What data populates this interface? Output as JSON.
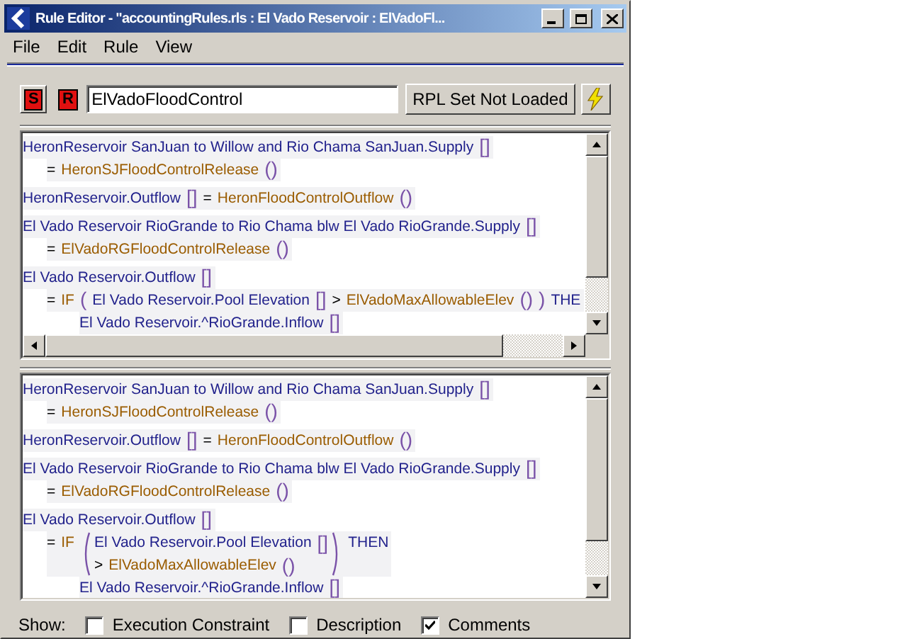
{
  "window": {
    "title": "Rule Editor - \"accountingRules.rls : El Vado Reservoir : ElVadoFl..."
  },
  "menu": [
    "File",
    "Edit",
    "Rule",
    "View"
  ],
  "toolbar": {
    "s_label": "S",
    "r_label": "R",
    "rule_name": "ElVadoFloodControl",
    "status_button": "RPL Set Not Loaded"
  },
  "panels": [
    {
      "horizontal_scrollbar": true,
      "rules": [
        {
          "lines": [
            {
              "kind": "head",
              "tokens": [
                {
                  "kind": "object",
                  "text": "HeronReservoir SanJuan to Willow and Rio Chama SanJuan.Supply"
                },
                {
                  "kind": "symbol",
                  "text": "[]"
                }
              ]
            },
            {
              "kind": "body",
              "tokens": [
                {
                  "kind": "operator",
                  "text": "="
                },
                {
                  "kind": "function",
                  "text": "HeronSJFloodControlRelease"
                },
                {
                  "kind": "symbol",
                  "text": "()"
                }
              ]
            }
          ]
        },
        {
          "lines": [
            {
              "kind": "head",
              "tokens": [
                {
                  "kind": "object",
                  "text": "HeronReservoir.Outflow"
                },
                {
                  "kind": "symbol",
                  "text": "[]"
                },
                {
                  "kind": "operator",
                  "text": "="
                },
                {
                  "kind": "function",
                  "text": "HeronFloodControlOutflow"
                },
                {
                  "kind": "symbol",
                  "text": "()"
                }
              ]
            }
          ]
        },
        {
          "lines": [
            {
              "kind": "head",
              "tokens": [
                {
                  "kind": "object",
                  "text": "El Vado Reservoir RioGrande to Rio Chama blw El Vado RioGrande.Supply"
                },
                {
                  "kind": "symbol",
                  "text": "[]"
                }
              ]
            },
            {
              "kind": "body",
              "tokens": [
                {
                  "kind": "operator",
                  "text": "="
                },
                {
                  "kind": "function",
                  "text": "ElVadoRGFloodControlRelease"
                },
                {
                  "kind": "symbol",
                  "text": "()"
                }
              ]
            }
          ]
        },
        {
          "lines": [
            {
              "kind": "head",
              "tokens": [
                {
                  "kind": "object",
                  "text": "El Vado Reservoir.Outflow"
                },
                {
                  "kind": "symbol",
                  "text": "[]"
                }
              ]
            },
            {
              "kind": "body",
              "tokens": [
                {
                  "kind": "operator",
                  "text": "="
                },
                {
                  "kind": "keyword",
                  "text": "IF"
                },
                {
                  "kind": "symbol",
                  "text": "("
                },
                {
                  "kind": "object",
                  "text": "El Vado Reservoir.Pool Elevation"
                },
                {
                  "kind": "symbol",
                  "text": "[]"
                },
                {
                  "kind": "operator",
                  "text": ">"
                },
                {
                  "kind": "function",
                  "text": "ElVadoMaxAllowableElev"
                },
                {
                  "kind": "symbol",
                  "text": "()"
                },
                {
                  "kind": "symbol",
                  "text": ")"
                },
                {
                  "kind": "object",
                  "text": "THE"
                }
              ]
            },
            {
              "kind": "nested",
              "tokens": [
                {
                  "kind": "object",
                  "text": "El Vado Reservoir.^RioGrande.Inflow"
                },
                {
                  "kind": "symbol",
                  "text": "[]"
                }
              ]
            }
          ]
        }
      ]
    },
    {
      "horizontal_scrollbar": false,
      "rules": [
        {
          "lines": [
            {
              "kind": "head",
              "tokens": [
                {
                  "kind": "object",
                  "text": "HeronReservoir SanJuan to Willow and Rio Chama SanJuan.Supply"
                },
                {
                  "kind": "symbol",
                  "text": "[]"
                }
              ]
            },
            {
              "kind": "body",
              "tokens": [
                {
                  "kind": "operator",
                  "text": "="
                },
                {
                  "kind": "function",
                  "text": "HeronSJFloodControlRelease"
                },
                {
                  "kind": "symbol",
                  "text": "()"
                }
              ]
            }
          ]
        },
        {
          "lines": [
            {
              "kind": "head",
              "tokens": [
                {
                  "kind": "object",
                  "text": "HeronReservoir.Outflow"
                },
                {
                  "kind": "symbol",
                  "text": "[]"
                },
                {
                  "kind": "operator",
                  "text": "="
                },
                {
                  "kind": "function",
                  "text": "HeronFloodControlOutflow"
                },
                {
                  "kind": "symbol",
                  "text": "()"
                }
              ]
            }
          ]
        },
        {
          "lines": [
            {
              "kind": "head",
              "tokens": [
                {
                  "kind": "object",
                  "text": "El Vado Reservoir RioGrande to Rio Chama blw El Vado RioGrande.Supply"
                },
                {
                  "kind": "symbol",
                  "text": "[]"
                }
              ]
            },
            {
              "kind": "body",
              "tokens": [
                {
                  "kind": "operator",
                  "text": "="
                },
                {
                  "kind": "function",
                  "text": "ElVadoRGFloodControlRelease"
                },
                {
                  "kind": "symbol",
                  "text": "()"
                }
              ]
            }
          ]
        },
        {
          "lines": [
            {
              "kind": "head",
              "tokens": [
                {
                  "kind": "object",
                  "text": "El Vado Reservoir.Outflow"
                },
                {
                  "kind": "symbol",
                  "text": "[]"
                }
              ]
            },
            {
              "kind": "body",
              "tokens": [
                {
                  "kind": "operator",
                  "text": "="
                },
                {
                  "kind": "keyword",
                  "text": "IF"
                },
                {
                  "kind": "group",
                  "lines": [
                    {
                      "tokens": [
                        {
                          "kind": "object",
                          "text": "El Vado Reservoir.Pool Elevation"
                        },
                        {
                          "kind": "symbol",
                          "text": "[]"
                        }
                      ]
                    },
                    {
                      "tokens": [
                        {
                          "kind": "operator",
                          "text": ">"
                        },
                        {
                          "kind": "function",
                          "text": "ElVadoMaxAllowableElev"
                        },
                        {
                          "kind": "symbol",
                          "text": "()"
                        }
                      ]
                    }
                  ]
                },
                {
                  "kind": "object",
                  "text": "THEN"
                }
              ]
            },
            {
              "kind": "nested",
              "tokens": [
                {
                  "kind": "object",
                  "text": "El Vado Reservoir.^RioGrande.Inflow"
                },
                {
                  "kind": "symbol",
                  "text": "[]"
                }
              ]
            }
          ]
        }
      ]
    }
  ],
  "show": {
    "label": "Show:",
    "options": [
      {
        "label": "Execution Constraint",
        "checked": false
      },
      {
        "label": "Description",
        "checked": false
      },
      {
        "label": "Comments",
        "checked": true
      }
    ]
  }
}
